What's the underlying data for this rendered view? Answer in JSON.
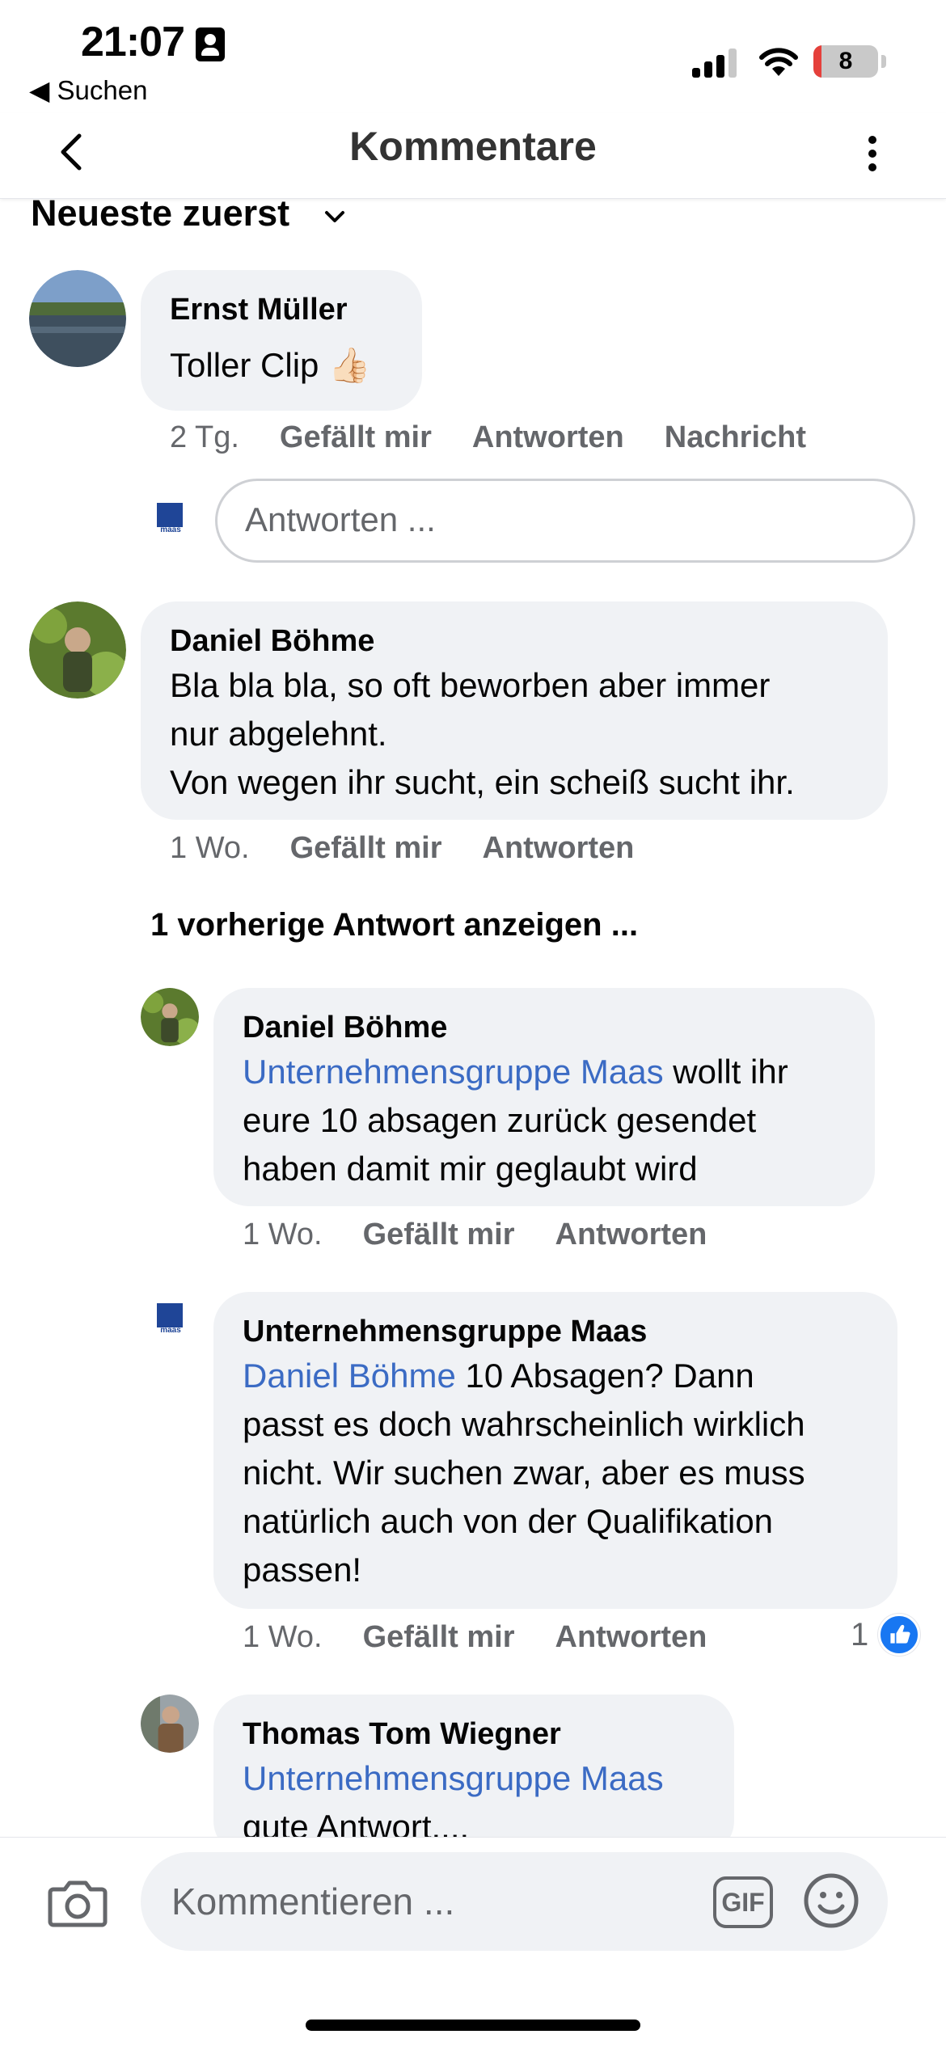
{
  "status_bar": {
    "time": "21:07",
    "back_app_label": "◀ Suchen",
    "battery_level": "8"
  },
  "nav": {
    "title": "Kommentare"
  },
  "sort": {
    "label": "Neueste zuerst"
  },
  "comments": [
    {
      "author": "Ernst Müller",
      "text": "Toller Clip 👍🏻",
      "age": "2 Tg.",
      "actions": [
        "Gefällt mir",
        "Antworten",
        "Nachricht"
      ]
    },
    {
      "author": "Daniel Böhme",
      "text_lines": [
        "Bla bla bla, so oft beworben aber immer",
        "nur abgelehnt.",
        "Von wegen ihr sucht, ein scheiß sucht ihr."
      ],
      "age": "1 Wo.",
      "actions": [
        "Gefällt mir",
        "Antworten"
      ]
    }
  ],
  "reply_input": {
    "placeholder": "Antworten ..."
  },
  "logo_text": "maas",
  "show_previous": "1 vorherige Antwort anzeigen ...",
  "replies": [
    {
      "author": "Daniel Böhme",
      "mention": "Unternehmensgruppe Maas",
      "text_first": " wollt ihr",
      "text_lines": [
        "eure 10 absagen zurück gesendet",
        "haben damit mir geglaubt wird"
      ],
      "age": "1 Wo.",
      "actions": [
        "Gefällt mir",
        "Antworten"
      ]
    },
    {
      "author": "Unternehmensgruppe Maas",
      "mention": "Daniel Böhme",
      "text_first": " 10 Absagen? Dann",
      "text_lines": [
        "passt es doch wahrscheinlich wirklich",
        "nicht. Wir suchen zwar, aber es muss",
        "natürlich auch von der Qualifikation",
        "passen!"
      ],
      "age": "1 Wo.",
      "actions": [
        "Gefällt mir",
        "Antworten"
      ],
      "like_count": "1"
    },
    {
      "author": "Thomas Tom Wiegner",
      "mention": "Unternehmensgruppe Maas",
      "text_lines": [
        "gute Antwort...."
      ]
    }
  ],
  "composer": {
    "placeholder": "Kommentieren ...",
    "gif_label": "GIF"
  },
  "colors": {
    "mention": "#3b6bc4",
    "bubble": "#f0f2f5",
    "meta_text": "#65676b",
    "like_blue": "#1877f2",
    "maas_blue": "#1f4597"
  }
}
